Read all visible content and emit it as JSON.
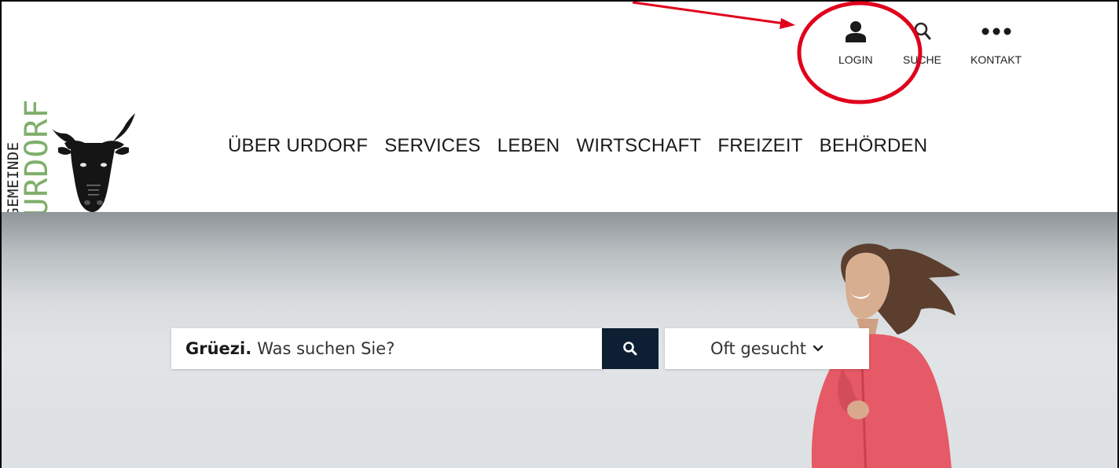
{
  "logo": {
    "line1": "GEMEINDE",
    "line2": "URDORF",
    "colors": {
      "gemeinde": "#1d1d1d",
      "urdorf": "#7fae6b"
    },
    "emblem_icon": "bull-head-icon"
  },
  "utility_nav": [
    {
      "label": "LOGIN",
      "icon": "user-icon"
    },
    {
      "label": "SUCHE",
      "icon": "search-icon"
    },
    {
      "label": "KONTAKT",
      "icon": "ellipsis-icon"
    }
  ],
  "main_nav": [
    {
      "label": "ÜBER URDORF"
    },
    {
      "label": "SERVICES"
    },
    {
      "label": "LEBEN"
    },
    {
      "label": "WIRTSCHAFT"
    },
    {
      "label": "FREIZEIT"
    },
    {
      "label": "BEHÖRDEN"
    }
  ],
  "hero": {
    "search": {
      "greeting": "Grüezi.",
      "placeholder": "Was suchen Sie?",
      "button_icon": "search-icon"
    },
    "often_searched": {
      "label": "Oft gesucht",
      "icon": "chevron-down-icon"
    }
  },
  "colors": {
    "search_button_bg": "#0e1f33",
    "annotation_red": "#e0001b"
  }
}
